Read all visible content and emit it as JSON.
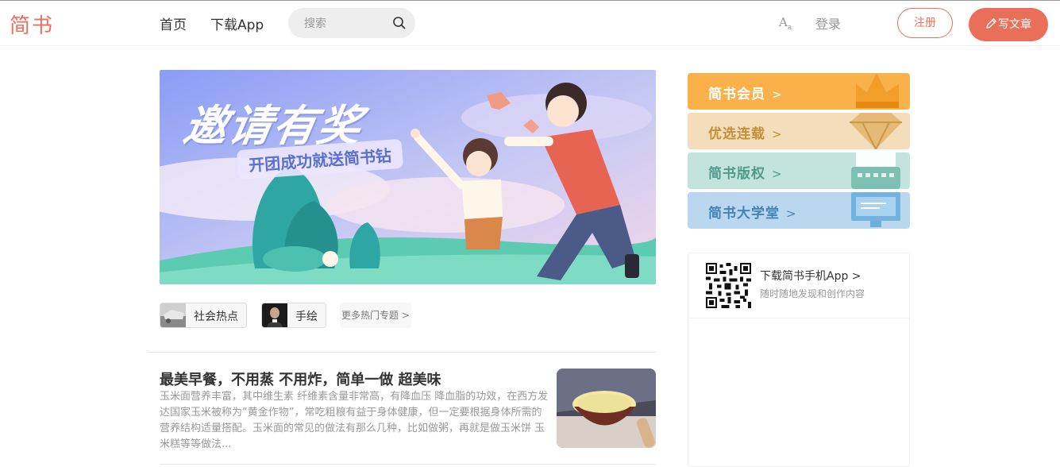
{
  "nav": {
    "logo": "简书",
    "home": "首页",
    "download_app": "下载App",
    "search_placeholder": "搜索",
    "font_toggle": "A",
    "font_toggle_sub": "a",
    "login": "登录",
    "register": "注册",
    "write": "写文章"
  },
  "banner": {
    "title": "邀请有奖",
    "subtitle": "开团成功就送简书钻"
  },
  "topics": [
    {
      "label": "社会热点"
    },
    {
      "label": "手绘"
    }
  ],
  "more_topics": "更多热门专题 >",
  "article": {
    "title": "最美早餐，不用蒸 不用炸，简单一做 超美味",
    "abstract": "玉米面营养丰富，其中维生素 纤维素含量非常高，有降血压 降血脂的功效，在西方发达国家玉米被称为“黄金作物”，常吃粗粮有益于身体健康，但一定要根据身体所需的营养结构适量搭配。玉米面的常见的做法有那么几种，比如做粥，再就是做玉米饼 玉米糕等等做法..."
  },
  "sidebar": {
    "cards": [
      {
        "label": "简书会员",
        "arrow": ">",
        "bg": "#fbb149",
        "color": "#ffffff",
        "icon": "crown-icon"
      },
      {
        "label": "优选连载",
        "arrow": ">",
        "bg": "#f4ddbb",
        "color": "#c48f36",
        "icon": "diamond-icon"
      },
      {
        "label": "简书版权",
        "arrow": ">",
        "bg": "#c3e3dd",
        "color": "#4f9b8b",
        "icon": "typewriter-icon"
      },
      {
        "label": "简书大学堂",
        "arrow": ">",
        "bg": "#b9d7ee",
        "color": "#4683b4",
        "icon": "screen-icon"
      }
    ],
    "download": {
      "title": "下载简书手机App >",
      "subtitle": "随时随地发现和创作内容"
    }
  },
  "colors": {
    "brand": "#ea6f5a"
  }
}
